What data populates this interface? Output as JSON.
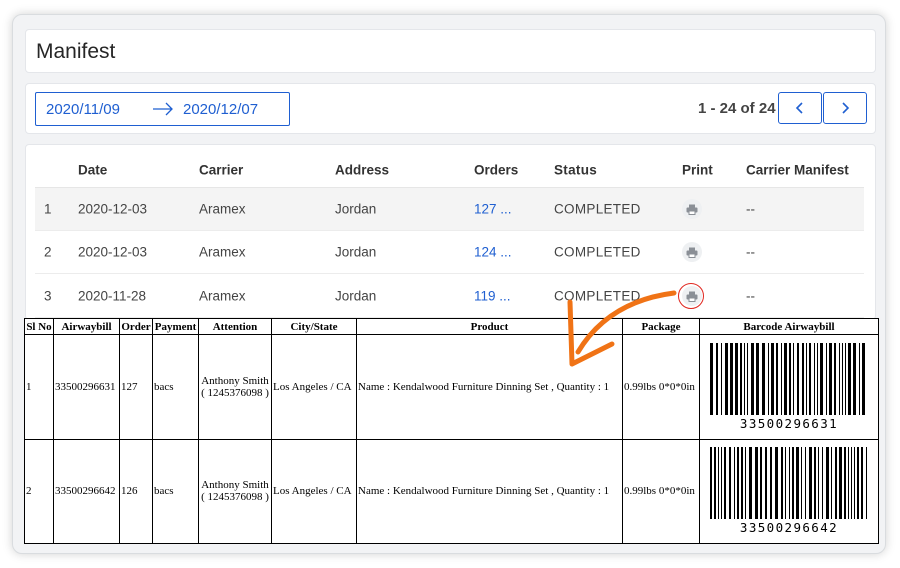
{
  "page": {
    "title": "Manifest"
  },
  "filters": {
    "date_from": "2020/11/09",
    "date_to": "2020/12/07",
    "pagination_info": "1 - 24 of 24"
  },
  "manifest_list": {
    "headers": [
      "Date",
      "Carrier",
      "Address",
      "Orders",
      "Status",
      "Print",
      "Carrier Manifest"
    ],
    "rows": [
      {
        "no": "1",
        "date": "2020-12-03",
        "carrier": "Aramex",
        "address": "Jordan",
        "orders": "127 ...",
        "status": "COMPLETED",
        "carrier_manifest": "--"
      },
      {
        "no": "2",
        "date": "2020-12-03",
        "carrier": "Aramex",
        "address": "Jordan",
        "orders": "124 ...",
        "status": "COMPLETED",
        "carrier_manifest": "--"
      },
      {
        "no": "3",
        "date": "2020-11-28",
        "carrier": "Aramex",
        "address": "Jordan",
        "orders": "119 ...",
        "status": "COMPLETED",
        "carrier_manifest": "--"
      }
    ]
  },
  "print_preview": {
    "headers": [
      "Sl No",
      "Airwaybill",
      "Order",
      "Payment",
      "Attention",
      "City/State",
      "Product",
      "Package",
      "Barcode Airwaybill"
    ],
    "rows": [
      {
        "sl": "1",
        "airwaybill": "33500296631",
        "order": "127",
        "payment": "bacs",
        "attention_name": "Anthony Smith",
        "attention_phone": "( 1245376098 )",
        "city_state": "Los Angeles / CA",
        "product": "Name : Kendalwood Furniture Dinning Set , Quantity : 1",
        "package": "0.99lbs 0*0*0in",
        "barcode_number": "33500296631"
      },
      {
        "sl": "2",
        "airwaybill": "33500296642",
        "order": "126",
        "payment": "bacs",
        "attention_name": "Anthony Smith",
        "attention_phone": "( 1245376098 )",
        "city_state": "Los Angeles / CA",
        "product": "Name : Kendalwood Furniture Dinning Set , Quantity : 1",
        "package": "0.99lbs 0*0*0in",
        "barcode_number": "33500296642"
      }
    ]
  },
  "colors": {
    "accent": "#1f5fd1",
    "annotation_arrow": "#f07316",
    "annotation_ring": "#e0261f"
  },
  "icons": [
    "arrow-right-icon",
    "chevron-left-icon",
    "chevron-right-icon",
    "printer-icon"
  ]
}
